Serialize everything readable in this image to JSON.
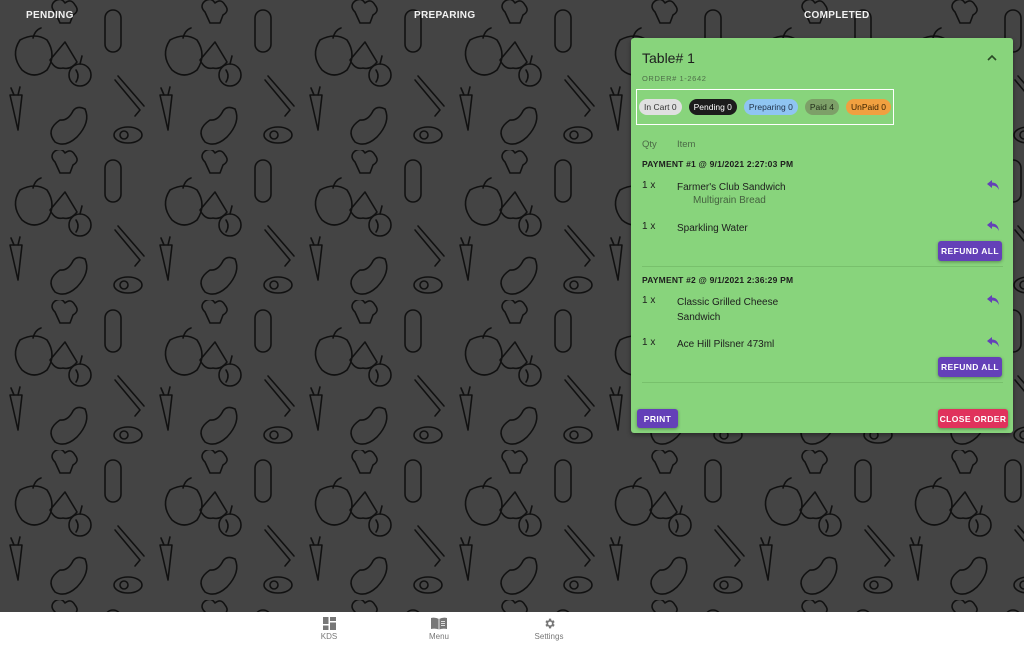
{
  "columns": {
    "pending": "PENDING",
    "preparing": "PREPARING",
    "completed": "COMPLETED"
  },
  "card": {
    "title": "Table# 1",
    "order_number": "ORDER# 1-2642",
    "collapse_icon": "chevron-up-icon",
    "background_color": "#88d47c",
    "chips": [
      {
        "label": "In Cart 0",
        "status": "in-cart",
        "color": "#e0e0e0"
      },
      {
        "label": "Pending 0",
        "status": "pending",
        "color": "#1c1c1c"
      },
      {
        "label": "Preparing 0",
        "status": "preparing",
        "color": "#8fc5f2"
      },
      {
        "label": "Paid 4",
        "status": "paid",
        "color": "#7da068"
      },
      {
        "label": "UnPaid 0",
        "status": "unpaid",
        "color": "#f0a040"
      }
    ],
    "column_headers": {
      "qty": "Qty",
      "item": "Item"
    },
    "payments": [
      {
        "header": "PAYMENT #1 @ 9/1/2021 2:27:03 PM",
        "items": [
          {
            "qty": "1 x",
            "name": "Farmer's Club Sandwich",
            "modifier": "Multigrain Bread",
            "action_icon": "undo-icon"
          },
          {
            "qty": "1 x",
            "name": "Sparkling Water",
            "modifier": "",
            "action_icon": "undo-icon"
          }
        ],
        "refund_label": "REFUND ALL"
      },
      {
        "header": "PAYMENT #2 @ 9/1/2021 2:36:29 PM",
        "items": [
          {
            "qty": "1 x",
            "name": "Classic Grilled Cheese Sandwich",
            "modifier": "",
            "action_icon": "undo-icon"
          },
          {
            "qty": "1 x",
            "name": "Ace Hill Pilsner 473ml",
            "modifier": "",
            "action_icon": "undo-icon"
          }
        ],
        "refund_label": "REFUND ALL"
      }
    ],
    "print_label": "PRINT",
    "close_order_label": "CLOSE ORDER",
    "accent_color": "#6440b8",
    "danger_color": "#e0325c"
  },
  "bottom_nav": [
    {
      "label": "KDS",
      "icon": "dashboard-icon"
    },
    {
      "label": "Menu",
      "icon": "menu-book-icon"
    },
    {
      "label": "Settings",
      "icon": "gear-icon"
    }
  ]
}
